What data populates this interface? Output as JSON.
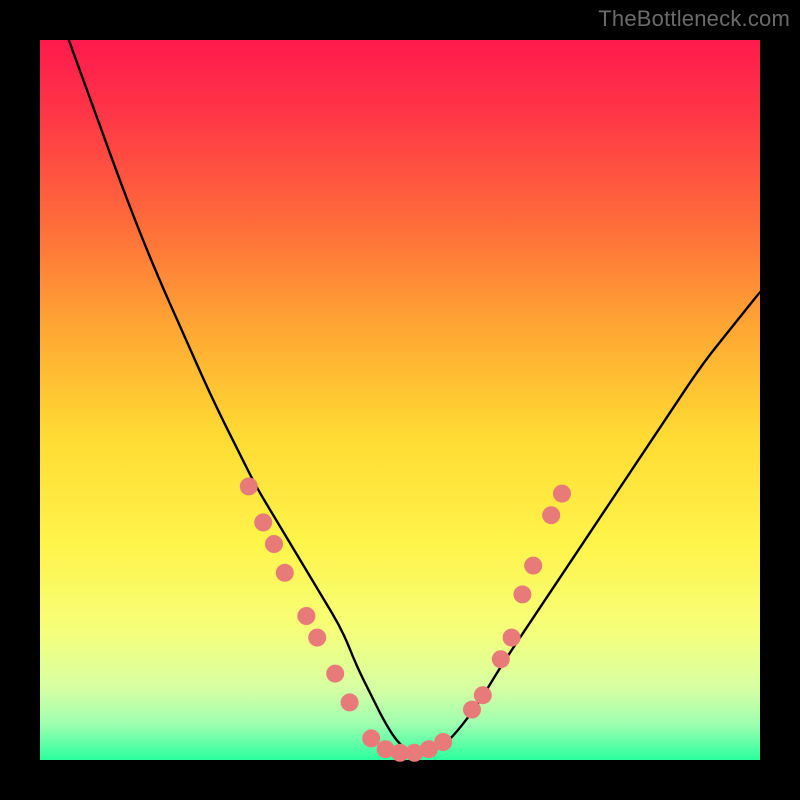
{
  "watermark": "TheBottleneck.com",
  "gradient": {
    "stops": [
      {
        "offset": 0.0,
        "color": "#ff1a4d"
      },
      {
        "offset": 0.1,
        "color": "#ff3547"
      },
      {
        "offset": 0.25,
        "color": "#ff6a3a"
      },
      {
        "offset": 0.4,
        "color": "#ffa733"
      },
      {
        "offset": 0.55,
        "color": "#ffdb33"
      },
      {
        "offset": 0.7,
        "color": "#fff44a"
      },
      {
        "offset": 0.82,
        "color": "#f6ff7a"
      },
      {
        "offset": 0.9,
        "color": "#d7ffa3"
      },
      {
        "offset": 0.95,
        "color": "#9effb0"
      },
      {
        "offset": 1.0,
        "color": "#2bff9e"
      }
    ]
  },
  "dot_color": "#e97a7a",
  "curve_color": "#000000",
  "chart_data": {
    "type": "line",
    "title": "",
    "xlabel": "",
    "ylabel": "",
    "xlim": [
      0,
      100
    ],
    "ylim": [
      0,
      100
    ],
    "series": [
      {
        "name": "bottleneck-curve",
        "x": [
          4,
          8,
          12,
          16,
          20,
          24,
          28,
          30,
          33,
          36,
          39,
          42,
          44,
          46,
          48,
          50,
          52,
          54,
          56,
          58,
          61,
          64,
          68,
          72,
          76,
          80,
          84,
          88,
          92,
          96,
          100
        ],
        "y": [
          100,
          89,
          78,
          68,
          59,
          50,
          42,
          38,
          33,
          28,
          23,
          18,
          13,
          9,
          5,
          2,
          1,
          1,
          2,
          4,
          8,
          13,
          19,
          25,
          31,
          37,
          43,
          49,
          55,
          60,
          65
        ]
      }
    ],
    "dots": [
      {
        "x": 29,
        "y": 38
      },
      {
        "x": 31,
        "y": 33
      },
      {
        "x": 32.5,
        "y": 30
      },
      {
        "x": 34,
        "y": 26
      },
      {
        "x": 37,
        "y": 20
      },
      {
        "x": 38.5,
        "y": 17
      },
      {
        "x": 41,
        "y": 12
      },
      {
        "x": 43,
        "y": 8
      },
      {
        "x": 46,
        "y": 3
      },
      {
        "x": 48,
        "y": 1.5
      },
      {
        "x": 50,
        "y": 1
      },
      {
        "x": 52,
        "y": 1
      },
      {
        "x": 54,
        "y": 1.5
      },
      {
        "x": 56,
        "y": 2.5
      },
      {
        "x": 60,
        "y": 7
      },
      {
        "x": 61.5,
        "y": 9
      },
      {
        "x": 64,
        "y": 14
      },
      {
        "x": 65.5,
        "y": 17
      },
      {
        "x": 67,
        "y": 23
      },
      {
        "x": 68.5,
        "y": 27
      },
      {
        "x": 71,
        "y": 34
      },
      {
        "x": 72.5,
        "y": 37
      }
    ]
  }
}
